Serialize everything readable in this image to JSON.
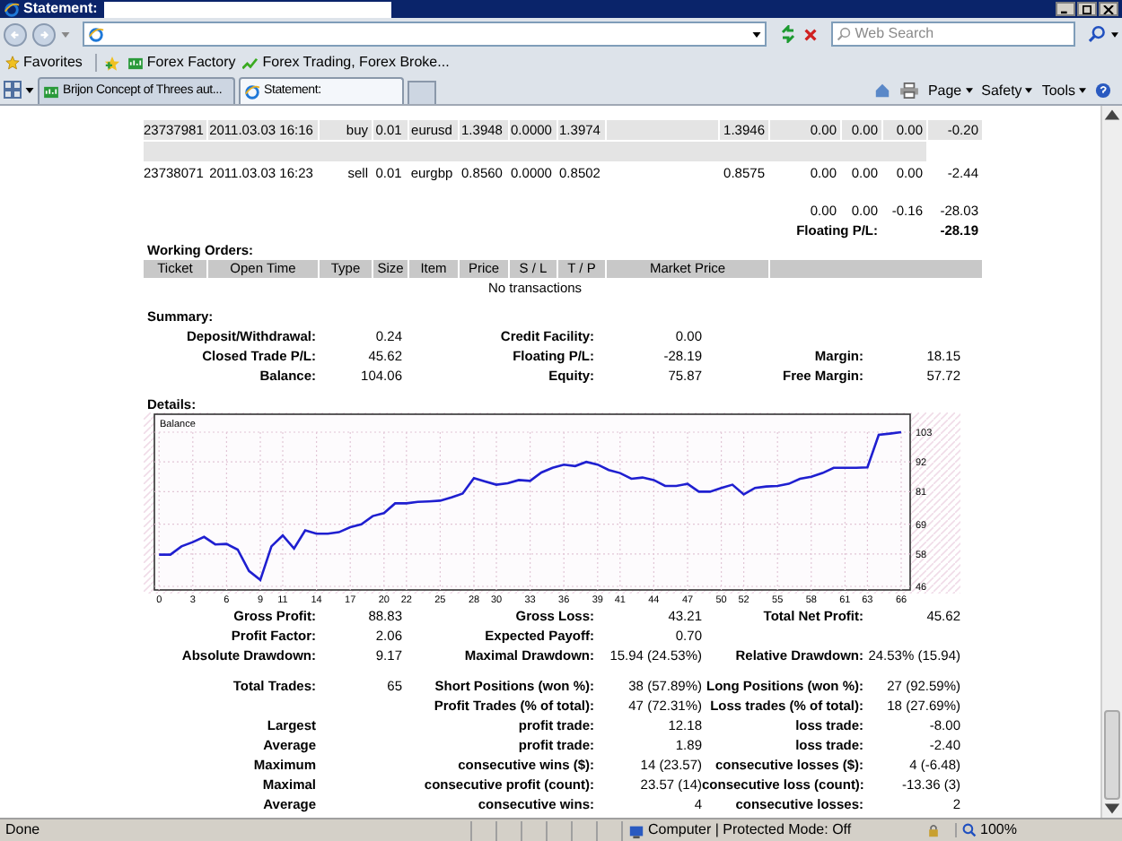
{
  "window": {
    "title": "Statement:"
  },
  "toolbar": {
    "search_placeholder": "Web Search"
  },
  "favorites": [
    {
      "label": "Favorites",
      "kind": "favorites"
    },
    {
      "label": "Forex Factory",
      "kind": "bar"
    },
    {
      "label": "Forex Trading, Forex Broke...",
      "kind": "chart"
    }
  ],
  "tabs": [
    {
      "label": "Brijon Concept of Threes aut...",
      "selected": false
    },
    {
      "label": "Statement:",
      "selected": true
    }
  ],
  "commands": [
    "Page",
    "Safety",
    "Tools"
  ],
  "trades": [
    {
      "kind": "trade",
      "shaded": true,
      "cells": [
        "23737981",
        "2011.03.03 16:16",
        "buy",
        "0.01",
        "eurusd",
        "1.3948",
        "0.0000",
        "1.3974",
        "1.3946",
        "0.00",
        "0.00",
        "0.00",
        "-0.20"
      ]
    },
    {
      "kind": "spacer",
      "shaded": true
    },
    {
      "kind": "trade",
      "shaded": false,
      "cells": [
        "23738071",
        "2011.03.03 16:23",
        "sell",
        "0.01",
        "eurgbp",
        "0.8560",
        "0.0000",
        "0.8502",
        "0.8575",
        "0.00",
        "0.00",
        "0.00",
        "-2.44"
      ]
    }
  ],
  "totals": [
    "0.00",
    "0.00",
    "-0.16",
    "-28.03"
  ],
  "floating": {
    "label": "Floating P/L:",
    "value": "-28.19"
  },
  "working_orders": {
    "title": "Working Orders:",
    "columns": [
      "Ticket",
      "Open Time",
      "Type",
      "Size",
      "Item",
      "Price",
      "S / L",
      "T / P",
      "Market Price"
    ],
    "empty_text": "No transactions"
  },
  "summary": {
    "title": "Summary:",
    "rows": [
      {
        "left": {
          "label": "Deposit/Withdrawal:",
          "value": "0.24"
        },
        "middle": {
          "label": "Credit Facility:",
          "value": "0.00"
        }
      },
      {
        "left": {
          "label": "Closed Trade P/L:",
          "value": "45.62"
        },
        "middle": {
          "label": "Floating P/L:",
          "value": "-28.19"
        },
        "right": {
          "label": "Margin:",
          "value": "18.15"
        }
      },
      {
        "left": {
          "label": "Balance:",
          "value": "104.06"
        },
        "middle": {
          "label": "Equity:",
          "value": "75.87"
        },
        "right": {
          "label": "Free Margin:",
          "value": "57.72"
        }
      }
    ]
  },
  "details": {
    "title": "Details:",
    "chart_data": {
      "type": "line",
      "grid": true,
      "x": [
        0,
        1,
        2,
        3,
        4,
        5,
        6,
        7,
        8,
        9,
        10,
        11,
        12,
        13,
        14,
        15,
        16,
        17,
        18,
        19,
        20,
        21,
        22,
        23,
        24,
        25,
        26,
        27,
        28,
        29,
        30,
        31,
        32,
        33,
        34,
        35,
        36,
        37,
        38,
        39,
        40,
        41,
        42,
        43,
        44,
        45,
        46,
        47,
        48,
        49,
        50,
        51,
        52,
        53,
        54,
        55,
        56,
        57,
        58,
        59,
        60,
        61,
        62,
        63,
        64,
        65,
        66
      ],
      "xlim": [
        0,
        66
      ],
      "ylim": [
        46,
        103
      ],
      "xticks": [
        0,
        3,
        6,
        9,
        11,
        14,
        17,
        20,
        22,
        25,
        28,
        30,
        33,
        36,
        39,
        41,
        44,
        47,
        50,
        52,
        55,
        58,
        61,
        63,
        66
      ],
      "yticks": [
        46,
        58,
        69,
        81,
        92,
        103
      ],
      "series": [
        {
          "name": "Balance",
          "color": "#1f1fd0",
          "values": [
            57.7,
            57.7,
            60.8,
            62.4,
            64.3,
            61.5,
            61.7,
            59.6,
            51.7,
            48.4,
            60.8,
            64.8,
            60,
            66.7,
            65.5,
            65.5,
            66,
            67.9,
            68.9,
            72,
            73.1,
            76.7,
            76.7,
            77.2,
            77.4,
            77.7,
            78.9,
            80.3,
            86,
            84.8,
            83.6,
            84.1,
            85.3,
            85,
            88.1,
            89.8,
            91,
            90.5,
            92,
            91,
            89,
            87.9,
            85.8,
            86.2,
            85.3,
            83.1,
            83.1,
            83.9,
            81,
            81,
            82.4,
            83.6,
            80,
            82.4,
            82.9,
            83.1,
            83.9,
            85.8,
            86.5,
            87.9,
            89.8,
            89.8,
            89.8,
            90,
            102,
            102.5,
            103
          ]
        }
      ]
    }
  },
  "stats": [
    [
      {
        "left": {
          "label": "Gross Profit:",
          "value": "88.83"
        },
        "middle": {
          "label": "Gross Loss:",
          "value": "43.21"
        },
        "right": {
          "label": "Total Net Profit:",
          "value": "45.62"
        }
      },
      {
        "left": {
          "label": "Profit Factor:",
          "value": "2.06"
        },
        "middle": {
          "label": "Expected Payoff:",
          "value": "0.70"
        }
      },
      {
        "left": {
          "label": "Absolute Drawdown:",
          "value": "9.17"
        },
        "middle": {
          "label": "Maximal Drawdown:",
          "value": "15.94 (24.53%)"
        },
        "right": {
          "label": "Relative Drawdown:",
          "value": "24.53% (15.94)"
        }
      }
    ],
    [
      {
        "left": {
          "label": "Total Trades:",
          "value": "65"
        },
        "middle": {
          "label": "Short Positions (won %):",
          "value": "38 (57.89%)"
        },
        "right": {
          "label": "Long Positions (won %):",
          "value": "27 (92.59%)"
        }
      },
      {
        "middle": {
          "label": "Profit Trades (% of total):",
          "value": "47 (72.31%)"
        },
        "right": {
          "label": "Loss trades (% of total):",
          "value": "18 (27.69%)"
        }
      },
      {
        "left": {
          "label": "Largest"
        },
        "middle": {
          "label": "profit trade:",
          "value": "12.18"
        },
        "right": {
          "label": "loss trade:",
          "value": "-8.00"
        }
      },
      {
        "left": {
          "label": "Average"
        },
        "middle": {
          "label": "profit trade:",
          "value": "1.89"
        },
        "right": {
          "label": "loss trade:",
          "value": "-2.40"
        }
      },
      {
        "left": {
          "label": "Maximum"
        },
        "middle": {
          "label": "consecutive wins ($):",
          "value": "14 (23.57)"
        },
        "right": {
          "label": "consecutive losses ($):",
          "value": "4 (-6.48)"
        }
      },
      {
        "left": {
          "label": "Maximal"
        },
        "middle": {
          "label": "consecutive profit (count):",
          "value": "23.57 (14)"
        },
        "right": {
          "label": "consecutive loss (count):",
          "value": "-13.36 (3)"
        }
      },
      {
        "left": {
          "label": "Average"
        },
        "middle": {
          "label": "consecutive wins:",
          "value": "4"
        },
        "right": {
          "label": "consecutive losses:",
          "value": "2"
        }
      }
    ]
  ],
  "status_bar": {
    "text": "Done",
    "zone": "Computer | Protected Mode: Off",
    "zoom": "100%"
  }
}
